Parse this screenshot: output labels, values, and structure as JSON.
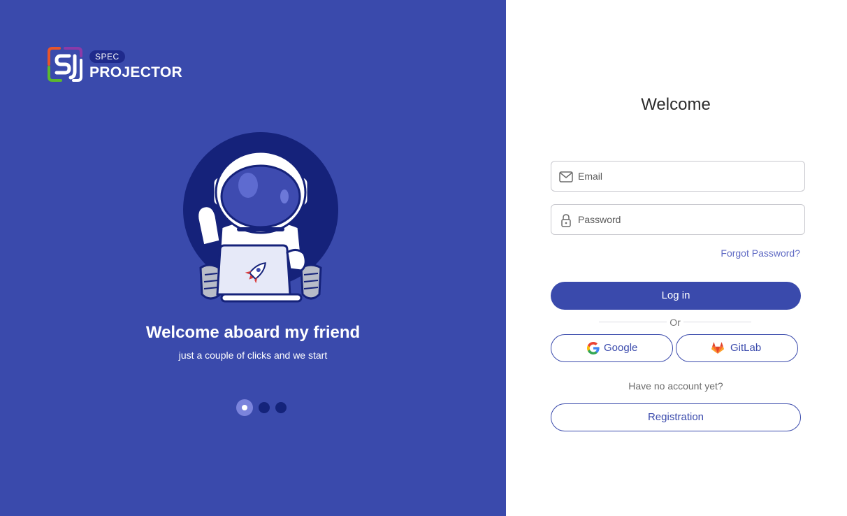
{
  "brand": {
    "badge": "SPEC",
    "name": "PROJECTOR",
    "colors": {
      "panel": "#3a4aac",
      "badge": "#1f2a8c",
      "accent": "#5f6ac4"
    }
  },
  "hero": {
    "title": "Welcome aboard my friend",
    "subtitle": "just a couple of clicks and we start",
    "illustration_icon": "astronaut-laptop-illustration",
    "carousel": {
      "total": 3,
      "active": 1
    }
  },
  "form": {
    "title": "Welcome",
    "email": {
      "placeholder": "Email",
      "value": "",
      "icon": "envelope-icon"
    },
    "password": {
      "placeholder": "Password",
      "value": "",
      "icon": "lock-icon"
    },
    "forgot_label": "Forgot Password?",
    "login_label": "Log in",
    "or_label": "Or",
    "google_label": "Google",
    "gitlab_label": "GitLab",
    "no_account_label": "Have no account yet?",
    "register_label": "Registration"
  }
}
